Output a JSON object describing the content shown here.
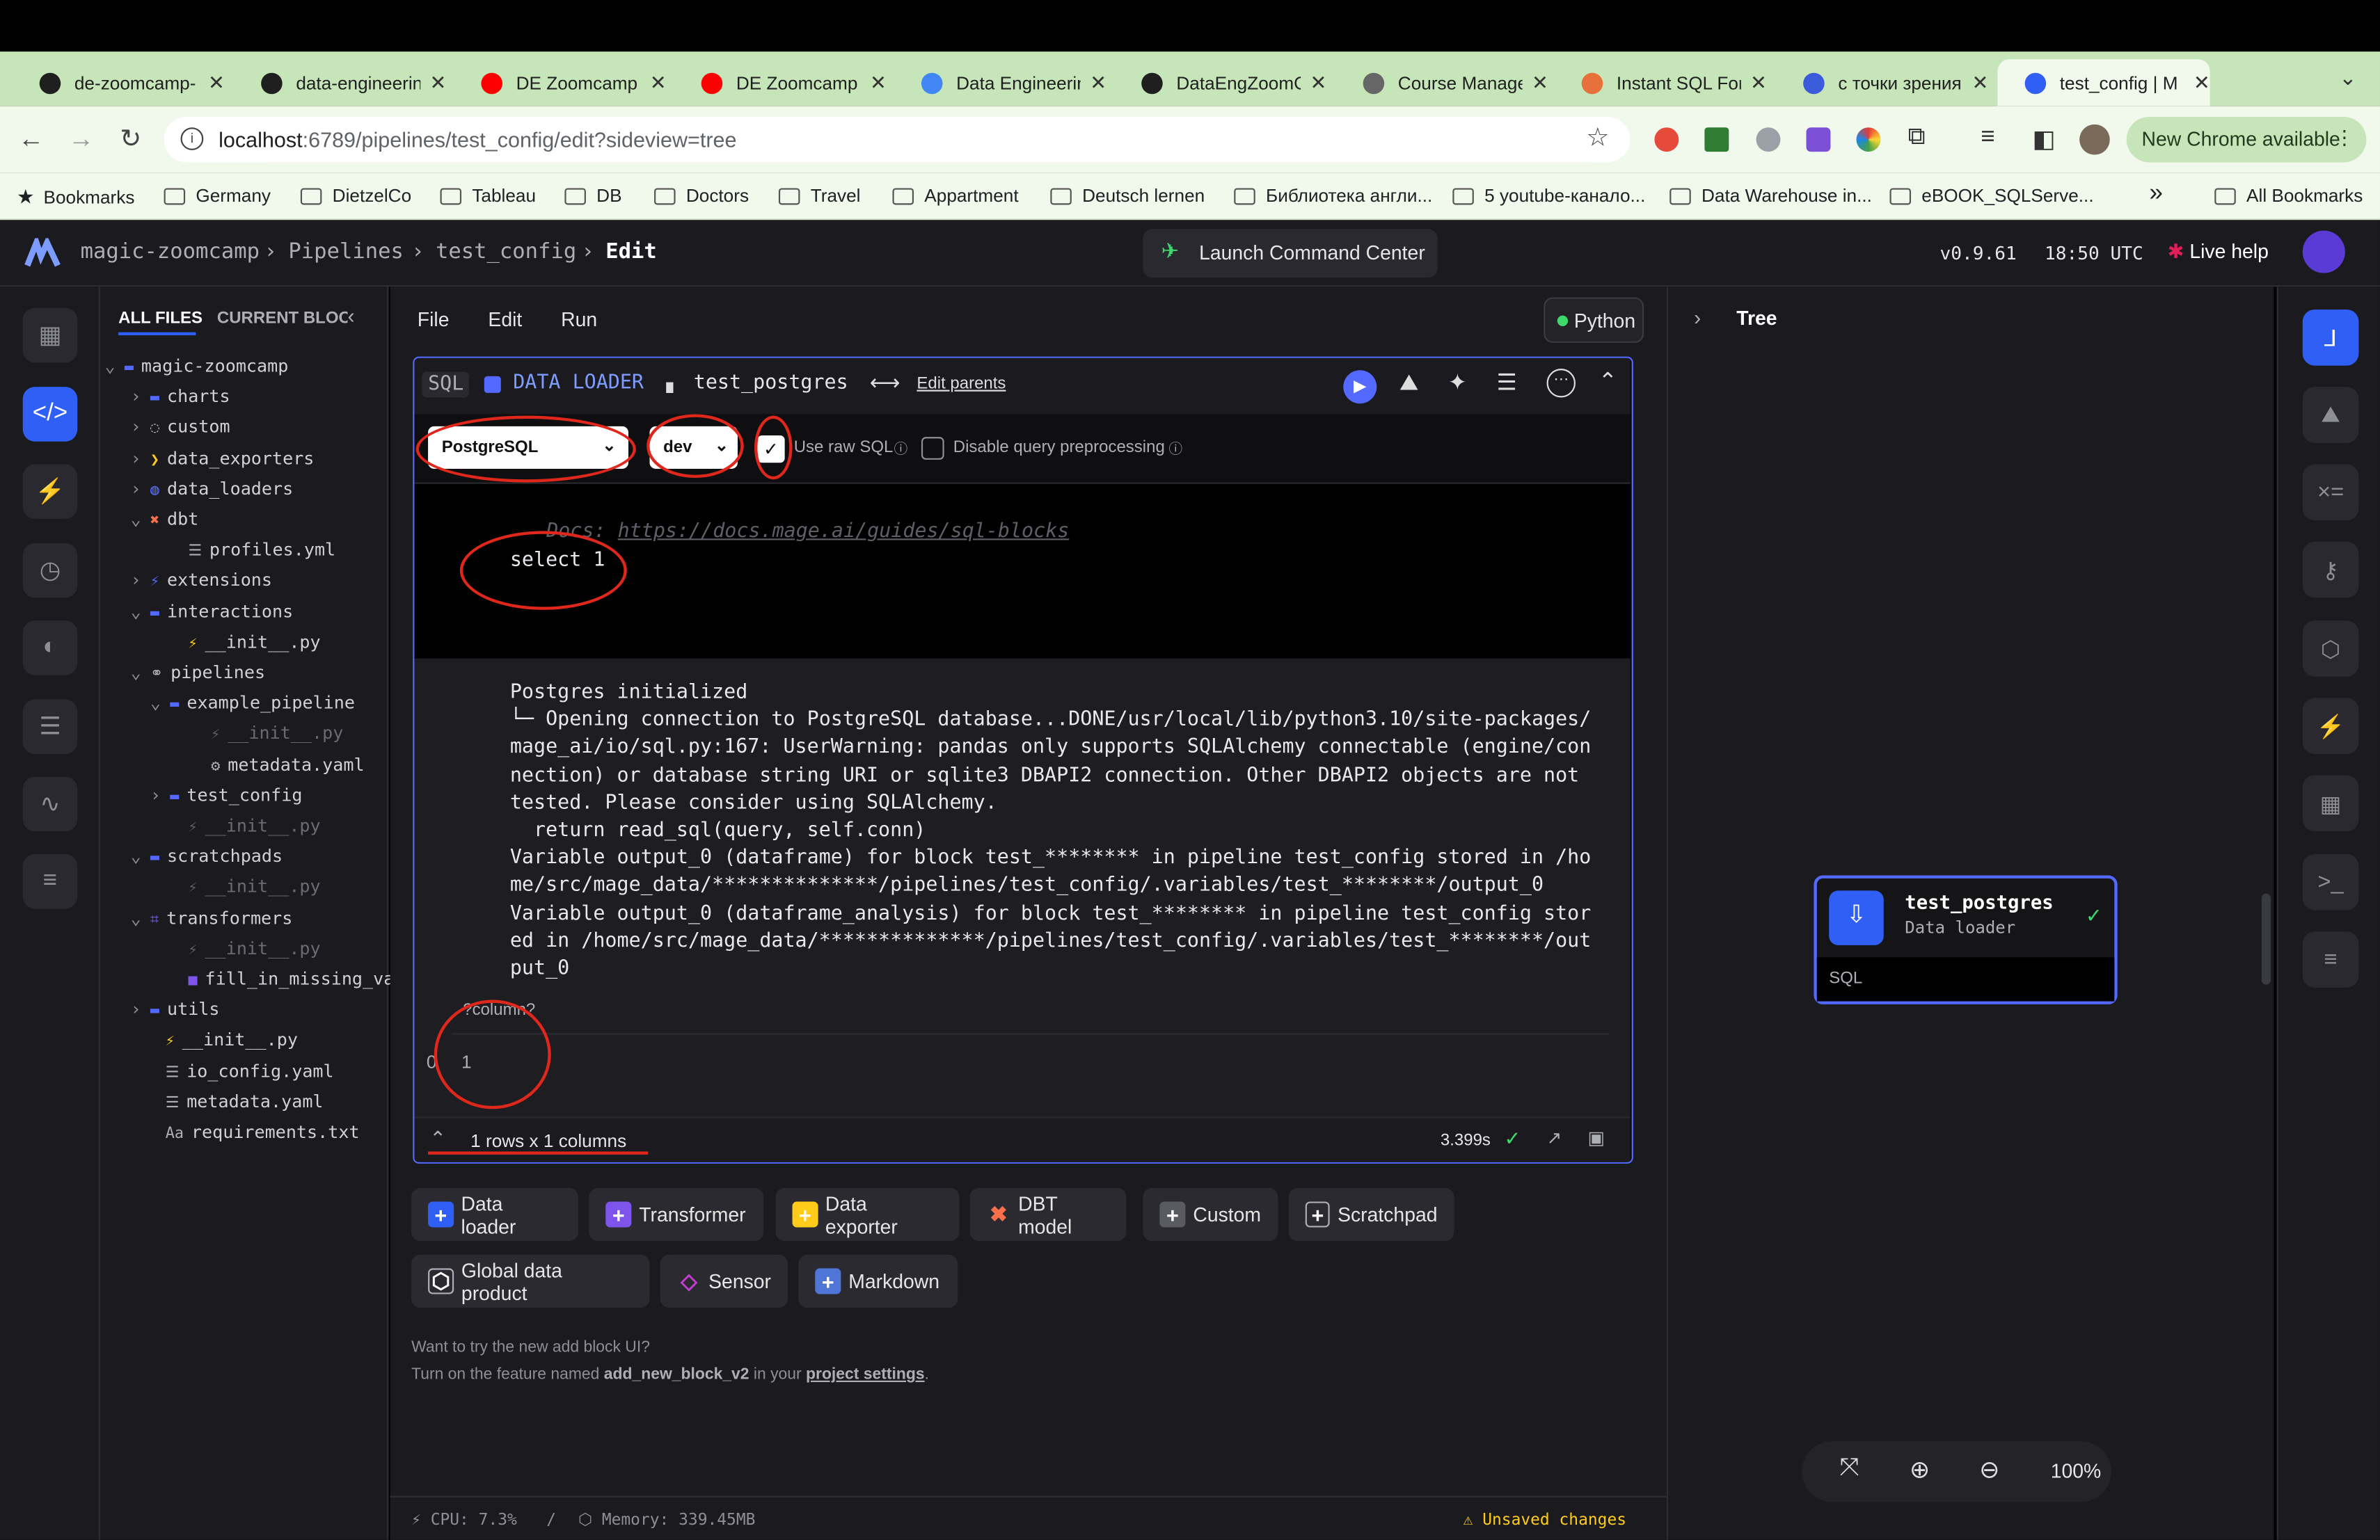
{
  "browser": {
    "tabs": [
      {
        "title": "de-zoomcamp-",
        "color": "#1f1f1f"
      },
      {
        "title": "data-engineerin",
        "color": "#1f1f1f"
      },
      {
        "title": "DE Zoomcamp",
        "color": "#ff0000"
      },
      {
        "title": "DE Zoomcamp",
        "color": "#ff0000"
      },
      {
        "title": "Data Engineerin",
        "color": "#4285f4"
      },
      {
        "title": "DataEngZoomC",
        "color": "#1f1f1f"
      },
      {
        "title": "Course Manage",
        "color": "#666666"
      },
      {
        "title": "Instant SQL For",
        "color": "#e8713b"
      },
      {
        "title": "с точки зрения",
        "color": "#3b5bdb"
      },
      {
        "title": "test_config | M",
        "color": "#2f5ff4"
      }
    ],
    "url_host": "localhost",
    "url_path": ":6789/pipelines/test_config/edit?sideview=tree",
    "new_chrome": "New Chrome available",
    "bookmarks": [
      "Bookmarks",
      "Germany",
      "DietzelCo",
      "Tableau",
      "DB",
      "Doctors",
      "Travel",
      "Appartment",
      "Deutsch lernen",
      "Библиотека англи...",
      "5 youtube-канало...",
      "Data Warehouse in...",
      "eBOOK_SQLServe..."
    ],
    "all_bookmarks": "All Bookmarks",
    "more": "»"
  },
  "header": {
    "project": "magic-zoomcamp",
    "pipelines": "Pipelines",
    "pipeline": "test_config",
    "mode": "Edit",
    "launch": "Launch Command Center",
    "version": "v0.9.61",
    "time": "18:50 UTC",
    "help": "Live help"
  },
  "filetree": {
    "tab_all": "ALL FILES",
    "tab_current": "CURRENT BLOCK",
    "items": [
      "magic-zoomcamp",
      "charts",
      "custom",
      "data_exporters",
      "data_loaders",
      "dbt",
      "profiles.yml",
      "extensions",
      "interactions",
      "__init__.py",
      "pipelines",
      "example_pipeline",
      "__init__.py",
      "metadata.yaml",
      "test_config",
      "__init__.py",
      "scratchpads",
      "__init__.py",
      "transformers",
      "__init__.py",
      "fill_in_missing_val",
      "utils",
      "__init__.py",
      "io_config.yaml",
      "metadata.yaml",
      "requirements.txt"
    ]
  },
  "editor": {
    "menu": [
      "File",
      "Edit",
      "Run"
    ],
    "kernel": "Python",
    "block_lang": "SQL",
    "block_type": "DATA LOADER",
    "block_name": "test_postgres",
    "edit_parents": "Edit parents",
    "connection": "PostgreSQL",
    "profile": "dev",
    "raw_sql": "Use raw SQL",
    "disable_pre": "Disable query preprocessing",
    "docs_label": "Docs: ",
    "docs_url": "https://docs.mage.ai/guides/sql-blocks",
    "code": "select 1",
    "output": "Postgres initialized\n└─ Opening connection to PostgreSQL database...DONE/usr/local/lib/python3.10/site-packages/\nmage_ai/io/sql.py:167: UserWarning: pandas only supports SQLAlchemy connectable (engine/con\nnection) or database string URI or sqlite3 DBAPI2 connection. Other DBAPI2 objects are not\ntested. Please consider using SQLAlchemy.\n  return read_sql(query, self.conn)\nVariable output_0 (dataframe) for block test_******** in pipeline test_config stored in /ho\nme/src/mage_data/**************/pipelines/test_config/.variables/test_********/output_0\nVariable output_0 (dataframe_analysis) for block test_******** in pipeline test_config stor\ned in /home/src/mage_data/**************/pipelines/test_config/.variables/test_********/out\nput_0",
    "table_header": "?column?",
    "row_index": "0",
    "row_value": "1",
    "shape": "1 rows x 1 columns",
    "runtime": "3.399s"
  },
  "add_blocks": [
    {
      "label": "Data loader",
      "color": "#2f5ff4"
    },
    {
      "label": "Transformer",
      "color": "#7d55ec"
    },
    {
      "label": "Data exporter",
      "color": "#ffcc19"
    },
    {
      "label": "DBT model",
      "color": "#fc6f4b"
    },
    {
      "label": "Custom",
      "color": "#5a5a63"
    },
    {
      "label": "Scratchpad",
      "color": "#2a2a30"
    },
    {
      "label": "Global data product",
      "color": "#2a2a30"
    },
    {
      "label": "Sensor",
      "color": "#c43dd3"
    },
    {
      "label": "Markdown",
      "color": "#4f75d6"
    }
  ],
  "hint": {
    "line1": "Want to try the new add block UI?",
    "line2a": "Turn on the feature named ",
    "feature": "add_new_block_v2",
    "line2b": " in your ",
    "settings": "project settings",
    "line2c": "."
  },
  "status": {
    "cpu": "CPU: 7.3%",
    "sep": "/",
    "memory": "Memory: 339.45MB",
    "unsaved": "Unsaved changes"
  },
  "tree": {
    "title": "Tree",
    "node_name": "test_postgres",
    "node_type": "Data loader",
    "node_lang": "SQL",
    "zoom": "100%"
  }
}
